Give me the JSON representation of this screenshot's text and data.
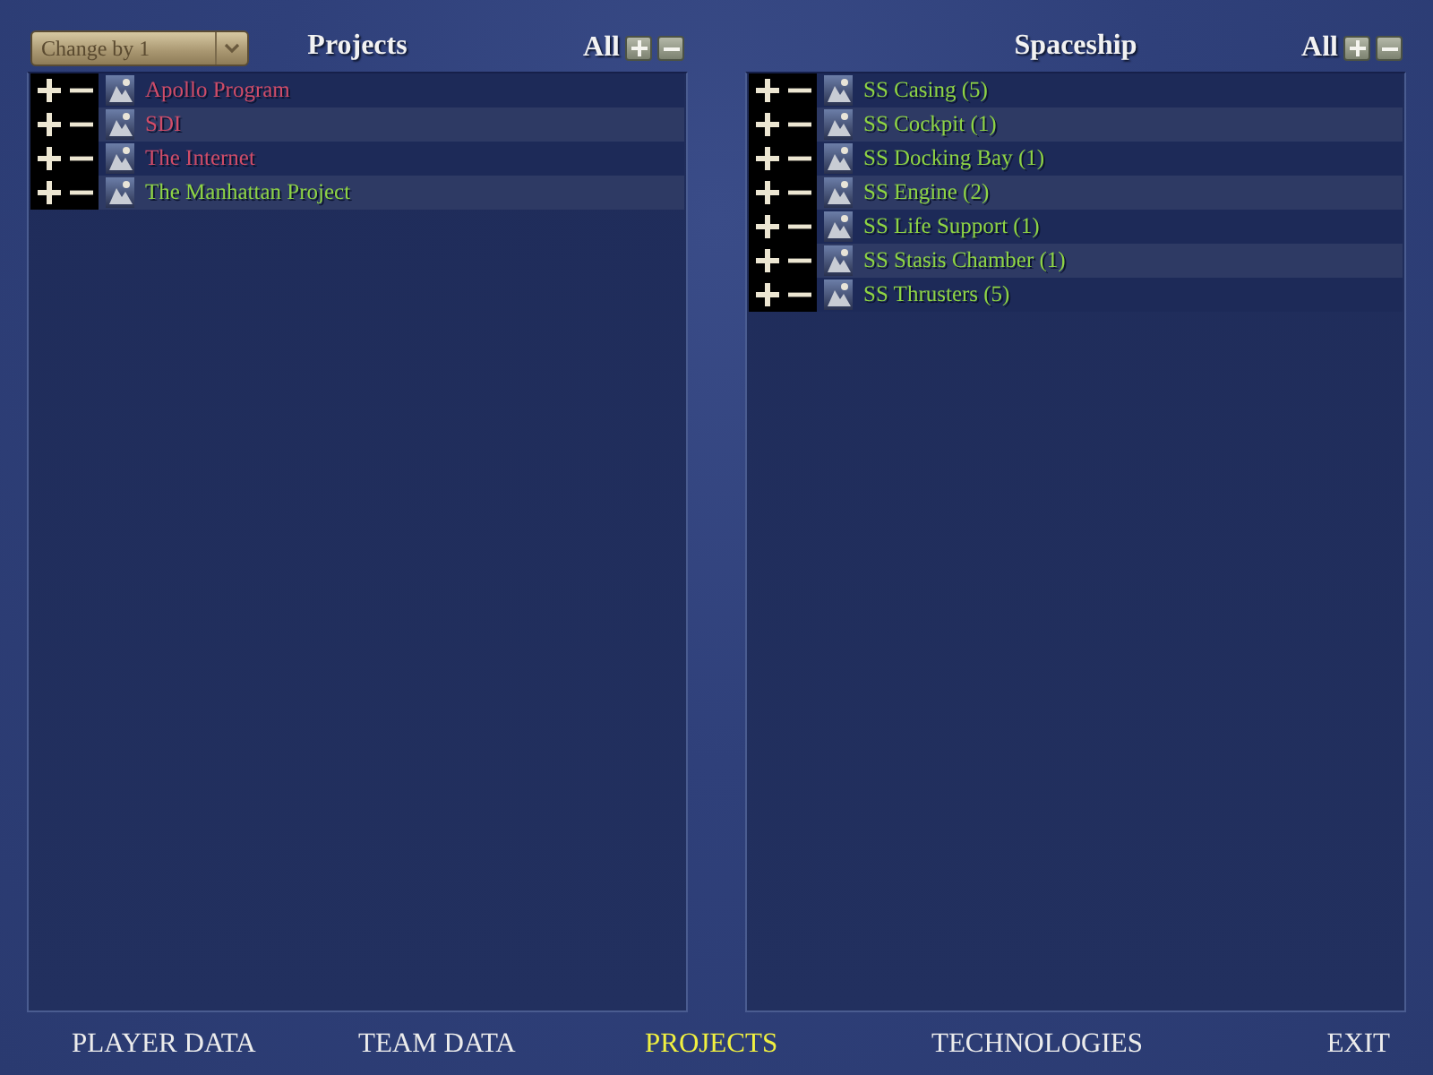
{
  "panels": [
    {
      "dropdown": {
        "value": "Change by 1"
      },
      "title": "Projects",
      "all_label": "All",
      "items": [
        {
          "label": "Apollo Program",
          "color": "#d04c68"
        },
        {
          "label": "SDI",
          "color": "#d04c68"
        },
        {
          "label": "The Internet",
          "color": "#d04c68"
        },
        {
          "label": "The Manhattan Project",
          "color": "#8ed444"
        }
      ]
    },
    {
      "title": "Spaceship",
      "all_label": "All",
      "items": [
        {
          "label": "SS Casing (5)",
          "color": "#8ed444"
        },
        {
          "label": "SS Cockpit (1)",
          "color": "#8ed444"
        },
        {
          "label": "SS Docking Bay (1)",
          "color": "#8ed444"
        },
        {
          "label": "SS Engine (2)",
          "color": "#8ed444"
        },
        {
          "label": "SS Life Support (1)",
          "color": "#8ed444"
        },
        {
          "label": "SS Stasis Chamber (1)",
          "color": "#8ed444"
        },
        {
          "label": "SS Thrusters (5)",
          "color": "#8ed444"
        }
      ]
    }
  ],
  "nav": [
    {
      "label": "PLAYER DATA",
      "selected": false
    },
    {
      "label": "TEAM DATA",
      "selected": false
    },
    {
      "label": "PROJECTS",
      "selected": true
    },
    {
      "label": "TECHNOLOGIES",
      "selected": false
    },
    {
      "label": "EXIT",
      "selected": false
    }
  ]
}
